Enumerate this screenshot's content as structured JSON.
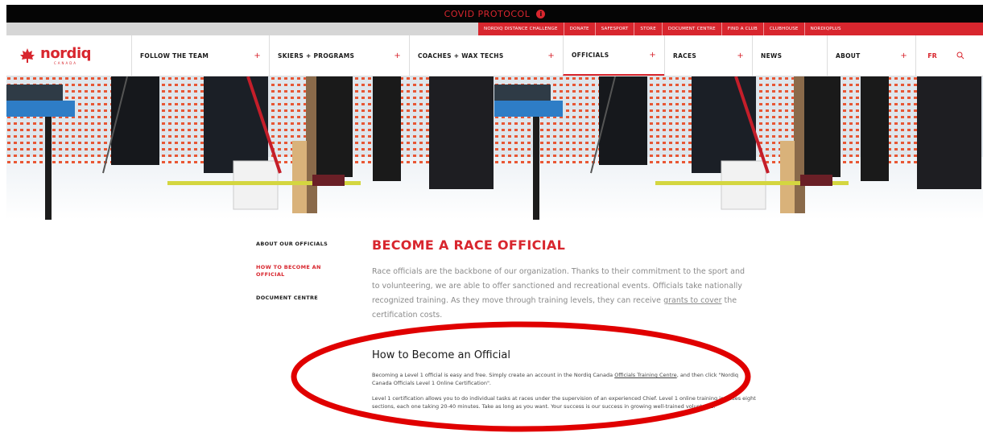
{
  "covid_bar": {
    "label": "COVID PROTOCOL"
  },
  "utility_nav": [
    "NORDIQ DISTANCE CHALLENGE",
    "DONATE",
    "SAFESPORT",
    "STORE",
    "DOCUMENT CENTRE",
    "FIND A CLUB",
    "CLUBHOUSE",
    "NORDIQPLUS"
  ],
  "brand": {
    "name": "nordiq",
    "sub": "CANADA"
  },
  "main_nav": [
    {
      "label": "FOLLOW THE TEAM",
      "expand": "+"
    },
    {
      "label": "SKIERS + PROGRAMS",
      "expand": "+"
    },
    {
      "label": "COACHES + WAX TECHS",
      "expand": "+"
    },
    {
      "label": "OFFICIALS",
      "expand": "+"
    },
    {
      "label": "RACES",
      "expand": "+"
    },
    {
      "label": "NEWS",
      "expand": ""
    },
    {
      "label": "ABOUT",
      "expand": "+"
    }
  ],
  "lang": "FR",
  "sidebar": [
    {
      "label": "ABOUT OUR OFFICIALS"
    },
    {
      "label": "HOW TO BECOME AN OFFICIAL"
    },
    {
      "label": "DOCUMENT CENTRE"
    }
  ],
  "page_title": "BECOME A RACE OFFICIAL",
  "intro": {
    "text_before": "Race officials are the backbone of our organization. Thanks to their commitment to the sport and to volunteering, we are able to offer sanctioned and recreational events. Officials take nationally recognized training. As they move through training levels, they can receive ",
    "link": "grants to cover",
    "text_after": " the certification costs."
  },
  "section_heading": "How to Become an Official",
  "para1": {
    "before": "Becoming a Level 1 official is easy and free. Simply create an account in the Nordiq Canada ",
    "link": "Officials Training Centre",
    "after": ", and then click \"Nordiq Canada Officials Level 1 Online Certification\"."
  },
  "para2": "Level 1 certification allows you to do individual tasks at races under the supervision of an experienced Chief. Level 1 online training includes eight sections, each one taking 20-40 minutes. Take as long as you want. Your success is our success in growing well-trained volunteers.",
  "colors": {
    "accent": "#d8262e",
    "topbar": "#050505"
  }
}
